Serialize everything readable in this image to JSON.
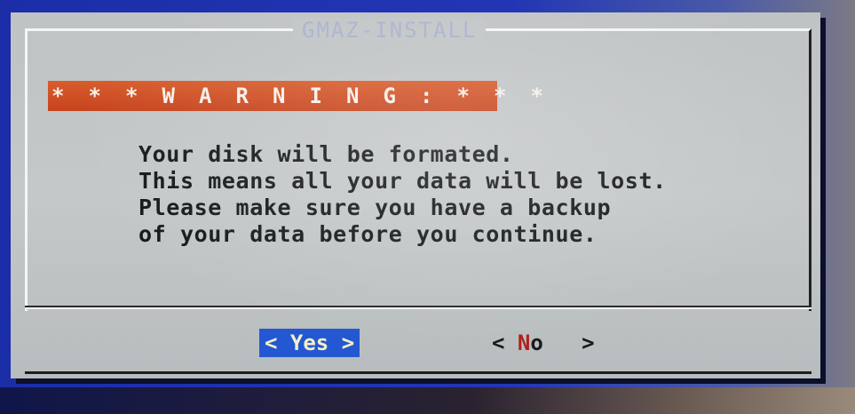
{
  "dialog": {
    "title": "GMAZ-INSTALL",
    "warning": "* * * W A R N I N G : * * *",
    "message_lines": [
      "Your disk will be formated.",
      "This means all your data will be lost.",
      "Please make sure you have a backup",
      "of your data before you continue."
    ]
  },
  "buttons": {
    "yes_label": "< Yes >",
    "no_left": "< ",
    "no_hotkey": "N",
    "no_rest": "o   >"
  },
  "colors": {
    "screen_bg": "#1b2ea8",
    "dialog_bg": "#c4c8c8",
    "warning_bg": "#c94a22",
    "selected_button_bg": "#2458d2",
    "hotkey": "#b0201c"
  }
}
